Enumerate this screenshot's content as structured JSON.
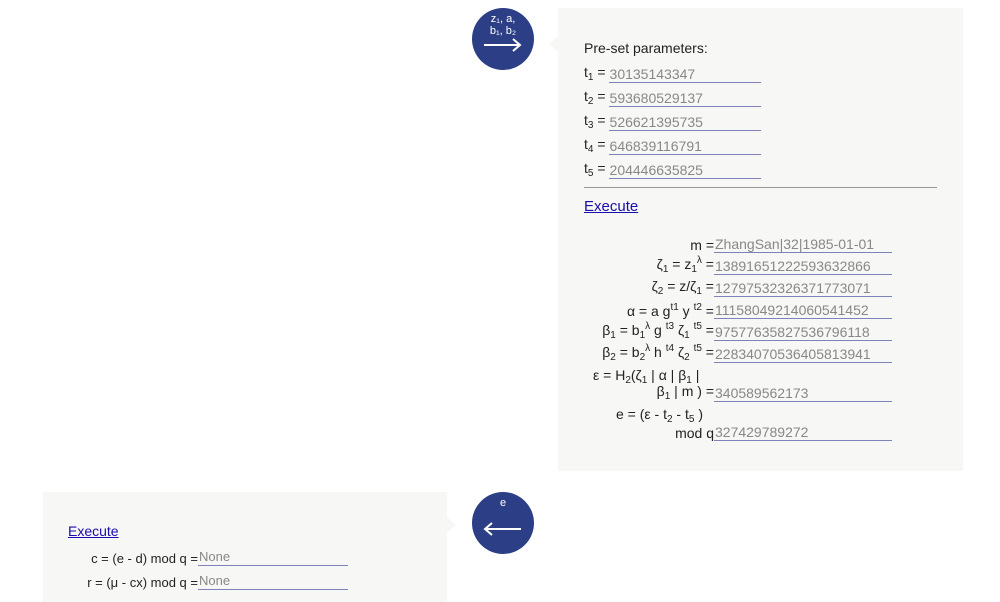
{
  "arrow_top": {
    "label_line1": "z₁, a,",
    "label_line2": "b₁, b₂",
    "icon": "arrow-right-icon"
  },
  "arrow_bottom": {
    "label": "e",
    "icon": "arrow-left-icon"
  },
  "right_panel": {
    "preset_title": "Pre-set parameters:",
    "params": [
      {
        "name": "t",
        "sub": "1",
        "value": "30135143347"
      },
      {
        "name": "t",
        "sub": "2",
        "value": "593680529137"
      },
      {
        "name": "t",
        "sub": "3",
        "value": "526621395735"
      },
      {
        "name": "t",
        "sub": "4",
        "value": "646839116791"
      },
      {
        "name": "t",
        "sub": "5",
        "value": "204446635825"
      }
    ],
    "execute_label": "Execute",
    "m_value": "ZhangSan|32|1985-01-01",
    "zeta1_value": "13891651222593632866",
    "zeta2_value": "12797532326371773071",
    "alpha_value": "11158049214060541452",
    "beta1_value": "97577635827536796118",
    "beta2_value": "22834070536405813941",
    "epsilon_value": "340589562173",
    "e_value": "327429789272"
  },
  "left_panel": {
    "execute_label": "Execute",
    "c_label": "c = (e - d) mod q =",
    "c_value": "None",
    "r_label": "r = (μ - cx) mod q =",
    "r_value": "None"
  }
}
